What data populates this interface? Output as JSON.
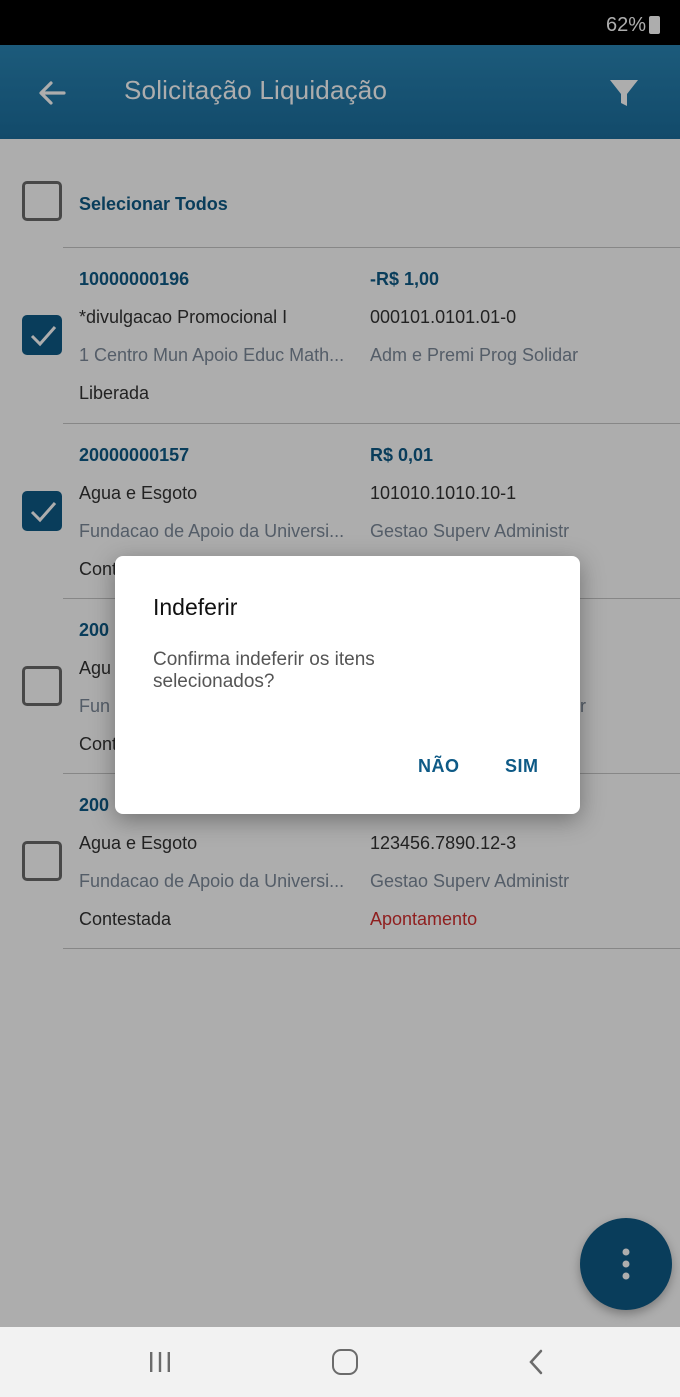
{
  "status_bar": {
    "battery": "62%"
  },
  "app_bar": {
    "title": "Solicitação Liquidação",
    "back_icon": "arrow-left-icon",
    "filter_icon": "filter-icon"
  },
  "select_all": {
    "label": "Selecionar Todos",
    "checked": false
  },
  "items": [
    {
      "code": "10000000196",
      "amount": "-R$ 1,00",
      "description": "*divulgacao Promocional I",
      "account": "000101.0101.01-0",
      "organization": "1 Centro Mun Apoio Educ Math...",
      "unit": "Adm e Premi Prog Solidar",
      "status": "Liberada",
      "flag": "",
      "checked": true
    },
    {
      "code": "20000000157",
      "amount": "R$ 0,01",
      "description": "Agua e Esgoto",
      "account": "101010.1010.10-1",
      "organization": "Fundacao de Apoio da Universi...",
      "unit": "Gestao Superv Administr",
      "status": "Cont",
      "flag": "",
      "checked": true
    },
    {
      "code": "200",
      "amount": "",
      "description": "Agu",
      "account": "",
      "organization": "Fun",
      "unit": "tr",
      "status": "Cont",
      "flag": "",
      "checked": false
    },
    {
      "code": "200",
      "amount": "",
      "description": "Agua e Esgoto",
      "account": "123456.7890.12-3",
      "organization": "Fundacao de Apoio da Universi...",
      "unit": "Gestao Superv Administr",
      "status": "Contestada",
      "flag": "Apontamento",
      "checked": false
    }
  ],
  "dialog": {
    "title": "Indeferir",
    "message": "Confirma indeferir os itens selecionados?",
    "no_label": "NÃO",
    "yes_label": "SIM"
  },
  "fab": {
    "icon": "more-vertical-icon"
  },
  "nav_bar": {
    "recent_icon": "recent-apps-icon",
    "home_icon": "home-icon",
    "back_icon": "back-icon"
  },
  "colors": {
    "primary": "#0e5a86",
    "app_bar": "#1f78a8",
    "flag_red": "#d32f2f"
  }
}
